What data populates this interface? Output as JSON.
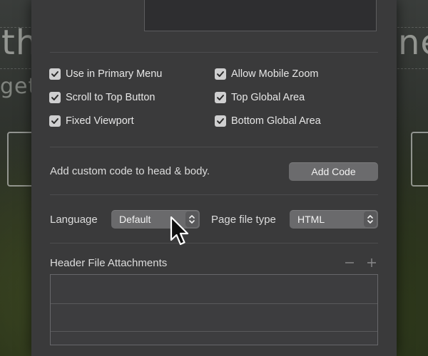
{
  "background": {
    "headline_left": "th",
    "headline_right": "ne",
    "subline_left": "get"
  },
  "options": {
    "use_primary_menu": {
      "label": "Use in Primary Menu",
      "checked": true
    },
    "allow_mobile_zoom": {
      "label": "Allow Mobile Zoom",
      "checked": true
    },
    "scroll_to_top": {
      "label": "Scroll to Top Button",
      "checked": true
    },
    "top_global_area": {
      "label": "Top Global Area",
      "checked": true
    },
    "fixed_viewport": {
      "label": "Fixed Viewport",
      "checked": true
    },
    "bottom_global_area": {
      "label": "Bottom Global Area",
      "checked": true
    }
  },
  "custom_code": {
    "description": "Add custom code to head & body.",
    "button_label": "Add Code"
  },
  "language": {
    "label": "Language",
    "value": "Default"
  },
  "page_file_type": {
    "label": "Page file type",
    "value": "HTML"
  },
  "header_attachments": {
    "label": "Header File Attachments",
    "remove_icon": "minus-icon",
    "add_icon": "plus-icon"
  },
  "colors": {
    "panel_bg": "#3a3a3b",
    "control_bg": "#6a6a6c",
    "checkbox_bg": "#cfcfd0",
    "text": "#e6e6e6"
  }
}
